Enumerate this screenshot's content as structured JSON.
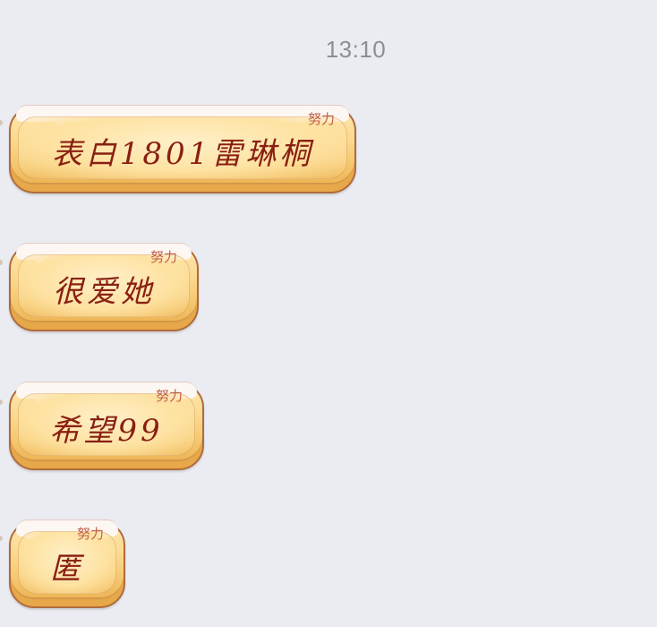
{
  "timestamp": "13:10",
  "messages": [
    {
      "text": "表白1801雷琳桐",
      "tag": "努力"
    },
    {
      "text": "很爱她",
      "tag": "努力"
    },
    {
      "text": "希望99",
      "tag": "努力"
    },
    {
      "text": "匿",
      "tag": "努力"
    }
  ],
  "colors": {
    "background": "#eaecf1",
    "bubble_fill": "#fbd98e",
    "bubble_border": "#b06b3c",
    "message_text": "#8a1f12",
    "tag_text": "#c0604a",
    "timestamp_text": "#8e8e93"
  }
}
